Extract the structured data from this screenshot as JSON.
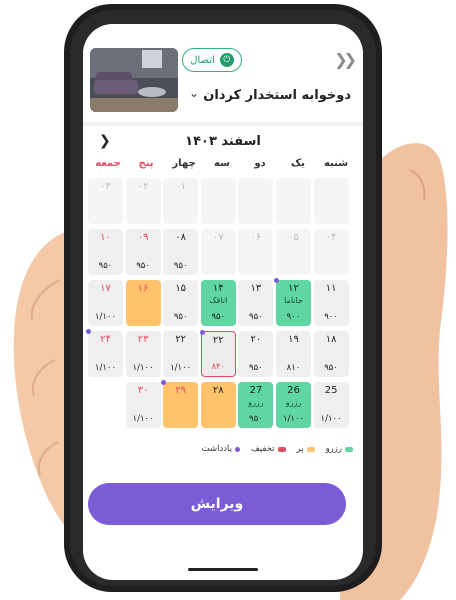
{
  "header": {
    "connect_label": "اتصال",
    "listing_title": "دوخوابه استخدار کردان",
    "back_icon": "double-chevron-right-icon",
    "chevron_icon": "chevron-down-icon"
  },
  "calendar": {
    "month_label": "اسفند ۱۴۰۳",
    "weekdays": [
      "شنبه",
      "یک",
      "دو",
      "سه",
      "چهار",
      "پنج",
      "جمعه"
    ],
    "rows": [
      [
        {
          "day": "",
          "type": "empty"
        },
        {
          "day": "",
          "type": "empty"
        },
        {
          "day": "",
          "type": "empty"
        },
        {
          "day": "",
          "type": "empty"
        },
        {
          "day": "۰۱",
          "type": "empty",
          "past": true
        },
        {
          "day": "۰۲",
          "type": "empty",
          "past": true
        },
        {
          "day": "۰۳",
          "type": "empty",
          "past": true
        }
      ],
      [
        {
          "day": "۰۴",
          "type": "empty",
          "past": true
        },
        {
          "day": "۰۵",
          "type": "empty",
          "past": true
        },
        {
          "day": "۰۶",
          "type": "empty",
          "past": true
        },
        {
          "day": "۰۷",
          "type": "empty",
          "past": true
        },
        {
          "day": "۰۸",
          "type": "gray",
          "price": "۹۵۰"
        },
        {
          "day": "۰۹",
          "type": "gray",
          "price": "۹۵۰",
          "red": true
        },
        {
          "day": "۱۰",
          "type": "gray",
          "price": "۹۵۰",
          "red": true
        }
      ],
      [
        {
          "day": "۱۱",
          "type": "gray",
          "price": "۹۰۰"
        },
        {
          "day": "۱۲",
          "type": "green",
          "guest": "جاناما",
          "price": "۹۰۰",
          "dot": true
        },
        {
          "day": "۱۳",
          "type": "gray",
          "price": "۹۵۰"
        },
        {
          "day": "۱۴",
          "type": "green",
          "guest": "اتاقک",
          "price": "۹۵۰"
        },
        {
          "day": "۱۵",
          "type": "gray",
          "price": "۹۵۰"
        },
        {
          "day": "۱۶",
          "type": "yellow",
          "red": true
        },
        {
          "day": "۱۷",
          "type": "gray",
          "price": "۱/۱۰۰",
          "red": true
        }
      ],
      [
        {
          "day": "۱۸",
          "type": "gray",
          "price": "۹۵۰"
        },
        {
          "day": "۱۹",
          "type": "gray",
          "price": "۸۱۰"
        },
        {
          "day": "۲۰",
          "type": "gray",
          "price": "۹۵۰"
        },
        {
          "day": "۲۲",
          "type": "today",
          "price": "۸۴۰",
          "dot": true,
          "price_red": true
        },
        {
          "day": "۲۲",
          "type": "gray",
          "price": "۱/۱۰۰"
        },
        {
          "day": "۲۳",
          "type": "gray",
          "price": "۱/۱۰۰",
          "red": true
        },
        {
          "day": "۲۴",
          "type": "gray",
          "price": "۱/۱۰۰",
          "red": true,
          "dot": true
        }
      ],
      [
        {
          "day": "25",
          "type": "gray",
          "price": "۱/۱۰۰"
        },
        {
          "day": "26",
          "type": "green",
          "guest": "رزرو",
          "price": "۱/۱۰۰"
        },
        {
          "day": "27",
          "type": "green",
          "guest": "رزرو",
          "price": "۹۵۰"
        },
        {
          "day": "۲۸",
          "type": "yellow"
        },
        {
          "day": "۲۹",
          "type": "yellow",
          "red": true,
          "dot": true
        },
        {
          "day": "۳۰",
          "type": "gray",
          "price": "۱/۱۰۰",
          "red": true
        },
        {
          "day": "",
          "type": "none"
        }
      ]
    ]
  },
  "legend": [
    {
      "label": "رزرو",
      "color": "#5fd6a4",
      "kind": "bar"
    },
    {
      "label": "پر",
      "color": "#ffc46b",
      "kind": "bar"
    },
    {
      "label": "تخفیف",
      "color": "#e84a5f",
      "kind": "bar"
    },
    {
      "label": "یادداشت",
      "color": "#7b5cd6",
      "kind": "dot"
    }
  ],
  "edit_label": "ویرایش"
}
